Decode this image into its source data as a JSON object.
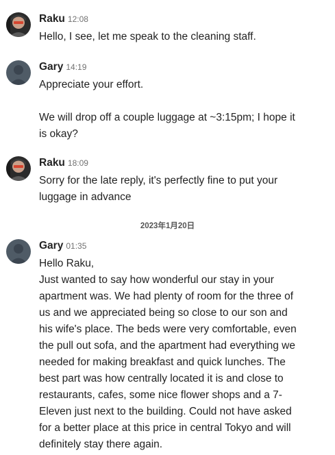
{
  "messages": [
    {
      "sender": "Raku",
      "time": "12:08",
      "avatar": "host-photo",
      "lines": [
        "Hello, I see, let me speak to the cleaning staff."
      ]
    },
    {
      "sender": "Gary",
      "time": "14:19",
      "avatar": "default-user-icon",
      "lines": [
        "Appreciate your effort.",
        "",
        "We will drop off a couple luggage at ~3:15pm; I hope it",
        "is okay?"
      ]
    },
    {
      "sender": "Raku",
      "time": "18:09",
      "avatar": "host-photo",
      "lines": [
        "Sorry for the late reply, it's perfectly fine to put your",
        "luggage in advance"
      ]
    },
    {
      "sender": "Gary",
      "time": "01:35",
      "avatar": "default-user-icon",
      "lines": [
        "Hello Raku,",
        "Just wanted to say how wonderful our stay in your",
        "apartment was. We had plenty of room for the three of",
        "us and we appreciated being so close to our son and",
        "his wife's place. The beds were very comfortable, even",
        "the pull out sofa, and the apartment had everything we",
        "needed for making breakfast and quick lunches. The",
        "best part was how centrally located it is and close to",
        "restaurants, cafes, some nice flower shops and a 7-",
        "Eleven just next to the building. Could not have asked",
        "for a better place at this price in central Tokyo and will",
        "definitely stay there again."
      ]
    }
  ],
  "date_separator": "2023年1月20日",
  "colors": {
    "text": "#222222",
    "timestamp": "#717171",
    "default_avatar_bg": "#4f5b66",
    "date_separator": "#555555"
  }
}
